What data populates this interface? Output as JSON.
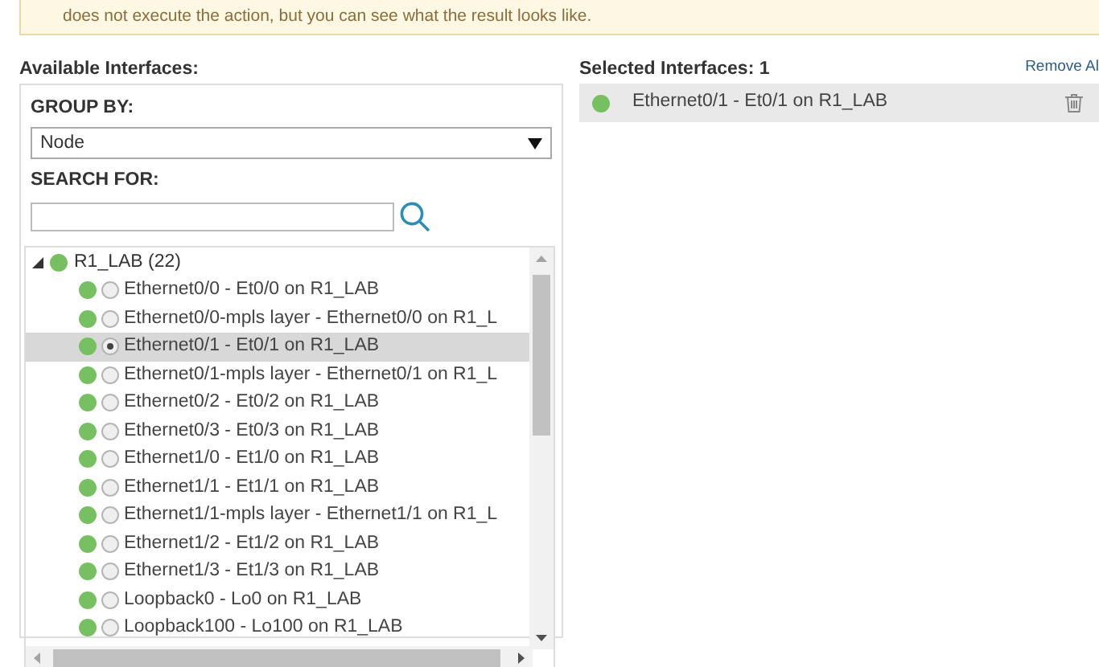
{
  "banner": {
    "text": "does not execute the action, but you can see what the result looks like."
  },
  "available": {
    "title": "Available Interfaces:",
    "group_by": {
      "label": "GROUP BY:",
      "value": "Node"
    },
    "search": {
      "label": "SEARCH FOR:"
    },
    "tree": {
      "label": "R1_LAB (22)",
      "expanded": true,
      "color": "#77c062",
      "children": [
        {
          "label": "Ethernet0/0 - Et0/0 on R1_LAB",
          "color": "#77c062",
          "selected": false
        },
        {
          "label": "Ethernet0/0-mpls layer - Ethernet0/0 on R1_L",
          "color": "#77c062",
          "selected": false
        },
        {
          "label": "Ethernet0/1 - Et0/1 on R1_LAB",
          "color": "#77c062",
          "selected": true
        },
        {
          "label": "Ethernet0/1-mpls layer - Ethernet0/1 on R1_L",
          "color": "#77c062",
          "selected": false
        },
        {
          "label": "Ethernet0/2 - Et0/2 on R1_LAB",
          "color": "#77c062",
          "selected": false
        },
        {
          "label": "Ethernet0/3 - Et0/3 on R1_LAB",
          "color": "#77c062",
          "selected": false
        },
        {
          "label": "Ethernet1/0 - Et1/0 on R1_LAB",
          "color": "#77c062",
          "selected": false
        },
        {
          "label": "Ethernet1/1 - Et1/1 on R1_LAB",
          "color": "#77c062",
          "selected": false
        },
        {
          "label": "Ethernet1/1-mpls layer - Ethernet1/1 on R1_L",
          "color": "#77c062",
          "selected": false
        },
        {
          "label": "Ethernet1/2 - Et1/2 on R1_LAB",
          "color": "#77c062",
          "selected": false
        },
        {
          "label": "Ethernet1/3 - Et1/3 on R1_LAB",
          "color": "#77c062",
          "selected": false
        },
        {
          "label": "Loopback0 - Lo0 on R1_LAB",
          "color": "#77c062",
          "selected": false
        },
        {
          "label": "Loopback100 - Lo100 on R1_LAB",
          "color": "#77c062",
          "selected": false
        }
      ]
    }
  },
  "selected": {
    "title": "Selected Interfaces: 1",
    "remove_all": "Remove Al",
    "items": [
      {
        "label": "Ethernet0/1 - Et0/1 on R1_LAB",
        "color": "#77c062"
      }
    ]
  }
}
